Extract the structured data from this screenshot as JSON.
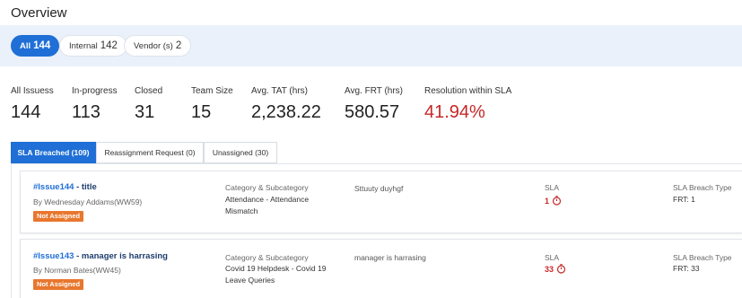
{
  "page": {
    "title": "Overview"
  },
  "filters": [
    {
      "label": "All",
      "count": "144",
      "active": true
    },
    {
      "label": "Internal",
      "count": "142",
      "active": false
    },
    {
      "label": "Vendor (s)",
      "count": "2",
      "active": false
    }
  ],
  "stats": [
    {
      "label": "All Issuess",
      "value": "144"
    },
    {
      "label": "In-progress",
      "value": "113"
    },
    {
      "label": "Closed",
      "value": "31"
    },
    {
      "label": "Team Size",
      "value": "15"
    },
    {
      "label": "Avg. TAT (hrs)",
      "value": "2,238.22"
    },
    {
      "label": "Avg. FRT (hrs)",
      "value": "580.57"
    },
    {
      "label": "Resolution within SLA",
      "value": "41.94%"
    }
  ],
  "tabs": [
    {
      "label": "SLA Breached (109)",
      "active": true
    },
    {
      "label": "Reassignment Request (0)",
      "active": false
    },
    {
      "label": "Unassigned (30)",
      "active": false
    }
  ],
  "columns": {
    "category": "Category & Subcategory",
    "sla": "SLA",
    "breach_type": "SLA Breach Type"
  },
  "issues": [
    {
      "id": "#Issue144",
      "title": " - title",
      "by": "By Wednesday Addams(WW59)",
      "status": "Not Assigned",
      "category": "Attendance - Attendance Mismatch",
      "description": "Sttuuty duyhgf",
      "sla": "1",
      "breach_type": "FRT: 1"
    },
    {
      "id": "#Issue143",
      "title": " - manager is harrasing",
      "by": "By Norman Bates(WW45)",
      "status": "Not Assigned",
      "category": "Covid 19 Helpdesk - Covid 19 Leave Queries",
      "description": "manager is harrasing",
      "sla": "33",
      "breach_type": "FRT: 33"
    }
  ],
  "colors": {
    "primary": "#1f6fd6",
    "danger": "#c62828",
    "badge": "#e8772e",
    "band": "#eaf1fb"
  }
}
